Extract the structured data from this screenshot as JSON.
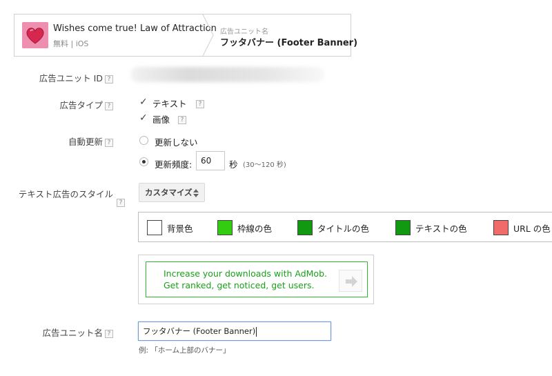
{
  "app": {
    "title": "Wishes come true! Law of Attraction",
    "subtitle": "無料 | iOS",
    "icon": "heart-icon"
  },
  "breadcrumb": {
    "label": "広告ユニット名",
    "value": "フッタバナー (Footer Banner)"
  },
  "help_glyph": "?",
  "fields": {
    "ad_unit_id_label": "広告ユニット ID",
    "ad_type_label": "広告タイプ",
    "ad_type_options": [
      "テキスト",
      "画像"
    ],
    "refresh_label": "自動更新",
    "refresh_off": "更新しない",
    "refresh_on": "更新頻度:",
    "refresh_value": "60",
    "refresh_unit": "秒",
    "refresh_range": "(30〜120 秒)",
    "style_label": "テキスト広告のスタイル",
    "style_select": "カスタマイズ",
    "ad_unit_name_label": "広告ユニット名",
    "ad_unit_name_value": "フッタバナー (Footer Banner)",
    "ad_unit_name_hint": "例: 「ホーム上部のバナー」"
  },
  "colors": [
    {
      "label": "背景色",
      "hex": "#ffffff"
    },
    {
      "label": "枠線の色",
      "hex": "#33cc11"
    },
    {
      "label": "タイトルの色",
      "hex": "#119911"
    },
    {
      "label": "テキストの色",
      "hex": "#119911"
    },
    {
      "label": "URL の色",
      "hex": "#f26b6b"
    }
  ],
  "preview": {
    "line1": "Increase your downloads with AdMob.",
    "line2": "Get ranked, get noticed, get users.",
    "border_color": "#2db82d",
    "text_color": "#19a019"
  }
}
